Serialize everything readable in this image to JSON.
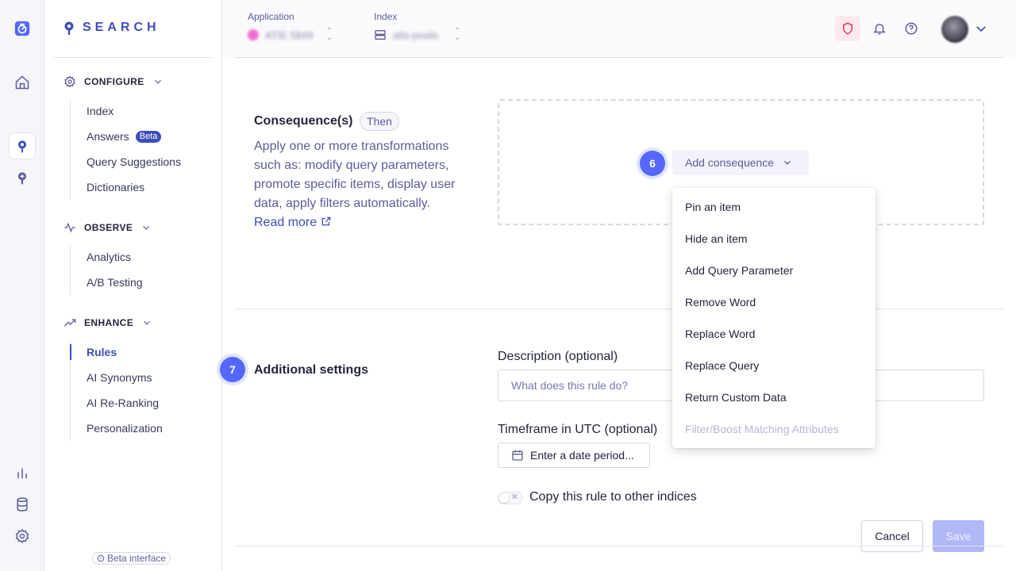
{
  "brand": {
    "name": "SEARCH",
    "accent": "#3d4eb8"
  },
  "rail": {
    "icons": [
      "logo-icon",
      "home-icon",
      "search-product-icon",
      "bulb-icon",
      "chart-icon",
      "database-icon",
      "gear-icon"
    ]
  },
  "sidebar": {
    "sections": [
      {
        "title": "CONFIGURE",
        "items": [
          {
            "label": "Index"
          },
          {
            "label": "Answers",
            "badge": "Beta"
          },
          {
            "label": "Query Suggestions"
          },
          {
            "label": "Dictionaries"
          }
        ]
      },
      {
        "title": "OBSERVE",
        "items": [
          {
            "label": "Analytics"
          },
          {
            "label": "A/B Testing"
          }
        ]
      },
      {
        "title": "ENHANCE",
        "items": [
          {
            "label": "Rules",
            "active": true
          },
          {
            "label": "AI Synonyms"
          },
          {
            "label": "AI Re-Ranking"
          },
          {
            "label": "Personalization"
          }
        ]
      }
    ],
    "beta_interface": "Beta interface"
  },
  "topbar": {
    "application_label": "Application",
    "application_value": "ATIE 5849",
    "index_label": "Index",
    "index_value": "atis-prods"
  },
  "consequence": {
    "title": "Consequence(s)",
    "tag": "Then",
    "description": "Apply one or more transformations such as: modify query parameters, promote specific items, display user data, apply filters automatically.",
    "read_more": "Read more",
    "step": "6",
    "add_button": "Add consequence",
    "menu": [
      {
        "label": "Pin an item",
        "disabled": false
      },
      {
        "label": "Hide an item",
        "disabled": false
      },
      {
        "label": "Add Query Parameter",
        "disabled": false
      },
      {
        "label": "Remove Word",
        "disabled": false
      },
      {
        "label": "Replace Word",
        "disabled": false
      },
      {
        "label": "Replace Query",
        "disabled": false
      },
      {
        "label": "Return Custom Data",
        "disabled": false
      },
      {
        "label": "Filter/Boost Matching Attributes",
        "disabled": true
      }
    ]
  },
  "additional": {
    "step": "7",
    "title": "Additional settings",
    "description_label": "Description (optional)",
    "description_placeholder": "What does this rule do?",
    "timeframe_label": "Timeframe in UTC (optional)",
    "date_button": "Enter a date period...",
    "copy_label": "Copy this rule to other indices",
    "copy_enabled": false
  },
  "actions": {
    "cancel": "Cancel",
    "save": "Save"
  },
  "colors": {
    "step": "#5468ff",
    "save_disabled": "#b1b8f7",
    "shield_bg": "#fde9ee"
  }
}
